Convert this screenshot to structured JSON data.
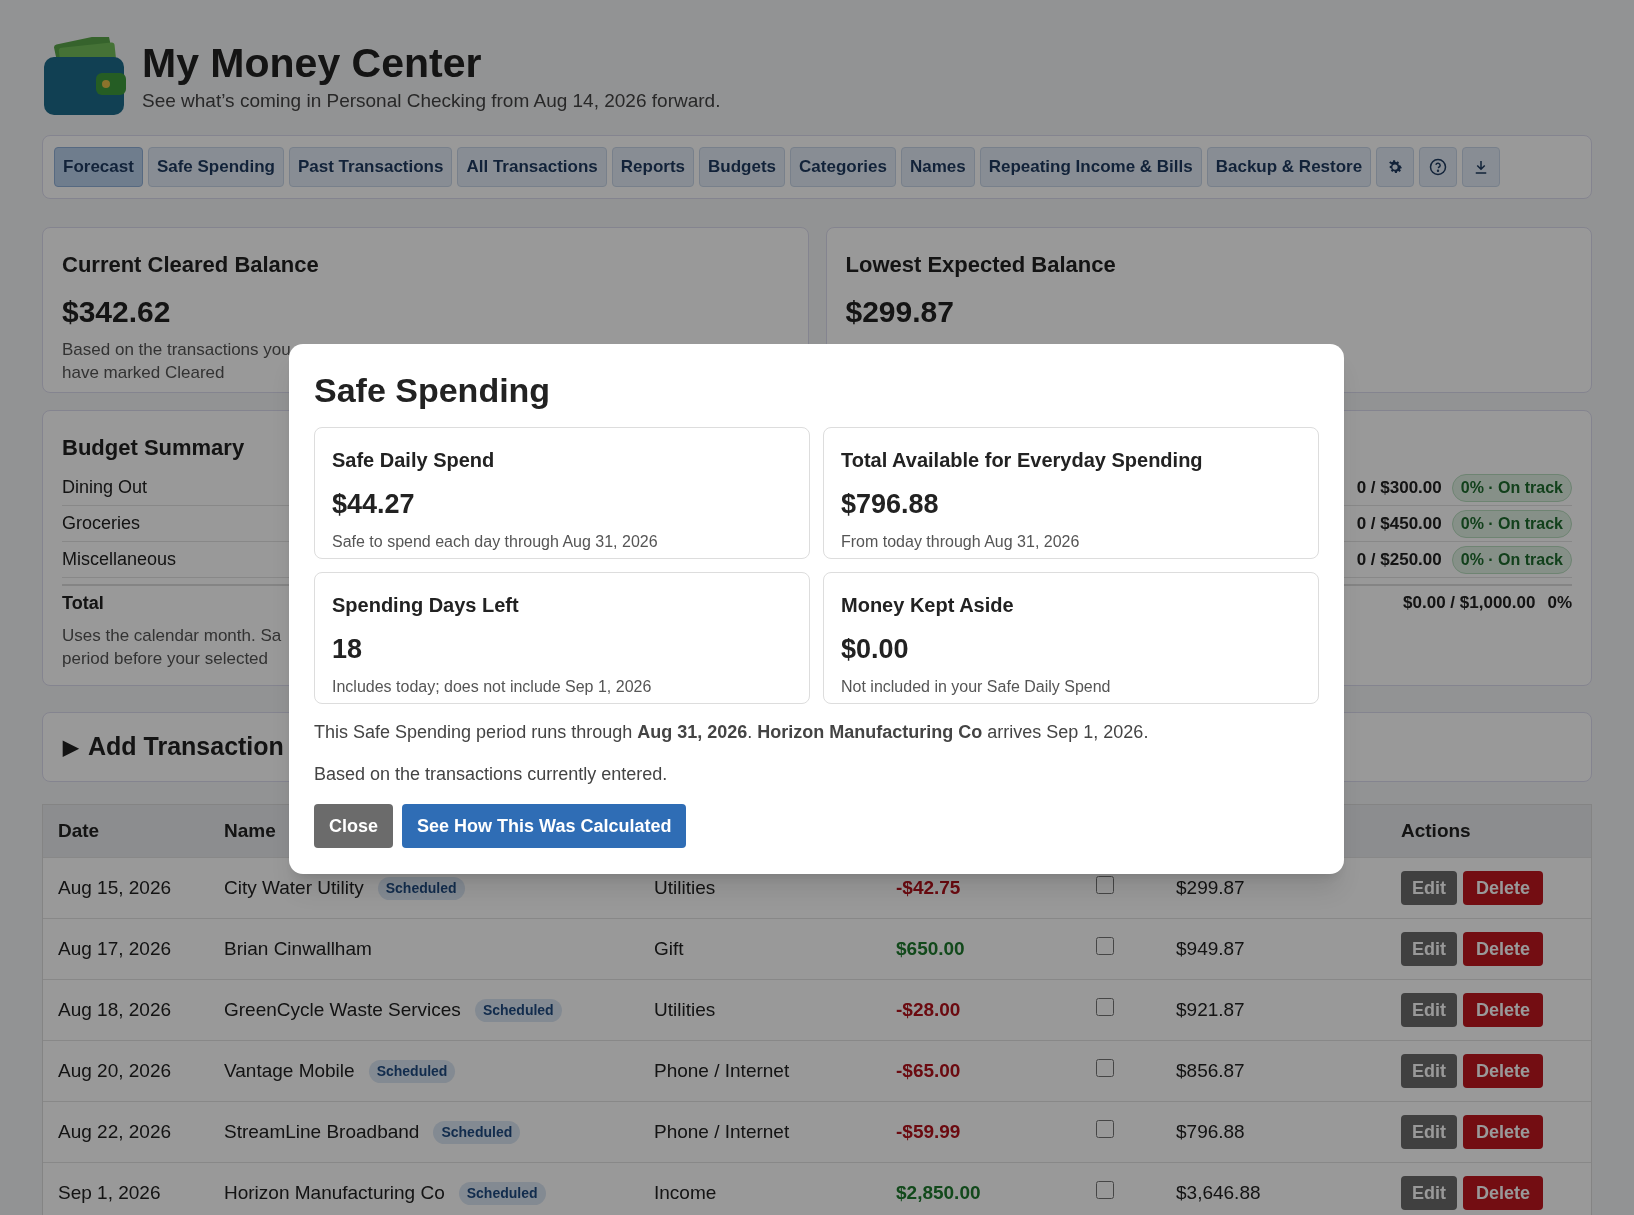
{
  "header": {
    "title": "My Money Center",
    "subtitle": "See what’s coming in Personal Checking from Aug 14, 2026 forward."
  },
  "tabs": [
    {
      "label": "Forecast",
      "selected": true
    },
    {
      "label": "Safe Spending",
      "selected": false
    },
    {
      "label": "Past Transactions",
      "selected": false
    },
    {
      "label": "All Transactions",
      "selected": false
    },
    {
      "label": "Reports",
      "selected": false
    },
    {
      "label": "Budgets",
      "selected": false
    },
    {
      "label": "Categories",
      "selected": false
    },
    {
      "label": "Names",
      "selected": false
    },
    {
      "label": "Repeating Income & Bills",
      "selected": false
    },
    {
      "label": "Backup & Restore",
      "selected": false
    }
  ],
  "tool_buttons": [
    {
      "kind": "settings"
    },
    {
      "kind": "help"
    },
    {
      "kind": "download"
    }
  ],
  "balance_cards": [
    {
      "title": "Current Cleared Balance",
      "amount": "$342.62",
      "lines": [
        "Based on the transactions you",
        "have marked Cleared"
      ]
    },
    {
      "title": "Lowest Expected Balance",
      "amount": "$299.87"
    }
  ],
  "budget_summary": {
    "title": "Budget Summary",
    "rows": [
      {
        "name": "Dining Out",
        "amount": "0 / $300.00",
        "badge": "0% · On track"
      },
      {
        "name": "Groceries",
        "amount": "0 / $450.00",
        "badge": "0% · On track"
      },
      {
        "name": "Miscellaneous",
        "amount": "0 / $250.00",
        "badge": "0% · On track"
      }
    ],
    "total": {
      "label": "Total",
      "amount": "$0.00 / $1,000.00",
      "percent": "0%"
    },
    "note_lines": [
      "Uses the calendar month. Sa",
      "period before your selected"
    ]
  },
  "add_transaction": {
    "arrow": "▶",
    "label": "Add Transaction",
    "expanded": false
  },
  "table": {
    "columns": [
      "Date",
      "Name",
      "Actions"
    ],
    "rows": [
      {
        "date": "Aug 15, 2026",
        "name": "City Water Utility",
        "badge": "Scheduled",
        "category": "Utilities",
        "amount": "-$42.75",
        "kind": "expense",
        "cleared": false,
        "balance": "$299.87",
        "edit": "Edit",
        "delete": "Delete"
      },
      {
        "date": "Aug 17, 2026",
        "name": "Brian Cinwallham",
        "category": "Gift",
        "amount": "$650.00",
        "kind": "income",
        "cleared": false,
        "balance": "$949.87",
        "edit": "Edit",
        "delete": "Delete"
      },
      {
        "date": "Aug 18, 2026",
        "name": "GreenCycle Waste Services",
        "badge": "Scheduled",
        "category": "Utilities",
        "amount": "-$28.00",
        "kind": "expense",
        "cleared": false,
        "balance": "$921.87",
        "edit": "Edit",
        "delete": "Delete"
      },
      {
        "date": "Aug 20, 2026",
        "name": "Vantage Mobile",
        "badge": "Scheduled",
        "category": "Phone / Internet",
        "amount": "-$65.00",
        "kind": "expense",
        "cleared": false,
        "balance": "$856.87",
        "edit": "Edit",
        "delete": "Delete"
      },
      {
        "date": "Aug 22, 2026",
        "name": "StreamLine Broadband",
        "badge": "Scheduled",
        "category": "Phone / Internet",
        "amount": "-$59.99",
        "kind": "expense",
        "cleared": false,
        "balance": "$796.88",
        "edit": "Edit",
        "delete": "Delete"
      },
      {
        "date": "Sep 1, 2026",
        "name": "Horizon Manufacturing Co",
        "badge": "Scheduled",
        "category": "Income",
        "amount": "$2,850.00",
        "kind": "income",
        "cleared": false,
        "balance": "$3,646.88",
        "edit": "Edit",
        "delete": "Delete"
      }
    ]
  },
  "dialog": {
    "title": "Safe Spending",
    "cards": [
      {
        "title": "Safe Daily Spend",
        "value": "$44.27",
        "note": "Safe to spend each day through Aug 31, 2026"
      },
      {
        "title": "Total Available for Everyday Spending",
        "value": "$796.88",
        "note": "From today through Aug 31, 2026"
      },
      {
        "title": "Spending Days Left",
        "value": "18",
        "note": "Includes today; does not include Sep 1, 2026"
      },
      {
        "title": "Money Kept Aside",
        "value": "$0.00",
        "note": "Not included in your Safe Daily Spend"
      }
    ],
    "summary": "This Safe Spending period runs through **Aug 31, 2026**. **Horizon Manufacturing Co** arrives Sep 1, 2026.",
    "basis": "Based on the transactions currently entered.",
    "buttons": [
      {
        "label": "Close",
        "kind": "secondary"
      },
      {
        "label": "See How This Was Calculated",
        "kind": "primary"
      }
    ]
  }
}
